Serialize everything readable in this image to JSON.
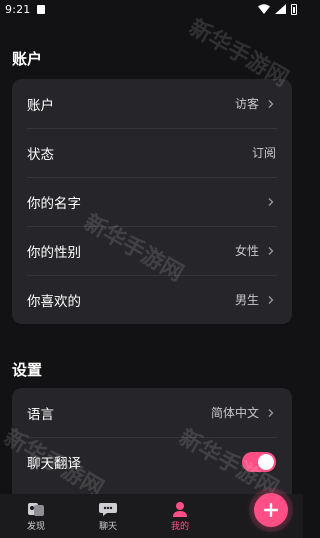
{
  "status_bar": {
    "time": "9:21",
    "notification_icon": "a-notification-icon",
    "wifi_icon": "wifi-icon",
    "cell_icon": "cell-signal-icon",
    "battery_icon": "battery-icon"
  },
  "account": {
    "title": "账户",
    "rows": [
      {
        "label": "账户",
        "value": "访客",
        "chevron": true
      },
      {
        "label": "状态",
        "value": "订阅",
        "chevron": false
      },
      {
        "label": "你的名字",
        "value": "",
        "chevron": true
      },
      {
        "label": "你的性别",
        "value": "女性",
        "chevron": true
      },
      {
        "label": "你喜欢的",
        "value": "男生",
        "chevron": true
      }
    ]
  },
  "settings": {
    "title": "设置",
    "rows": [
      {
        "label": "语言",
        "value": "简体中文",
        "chevron": true
      },
      {
        "label": "聊天翻译",
        "toggle_on": true
      }
    ]
  },
  "tabbar": {
    "tabs": [
      {
        "label": "发现",
        "icon": "discover-icon",
        "active": false
      },
      {
        "label": "聊天",
        "icon": "chat-icon",
        "active": false
      },
      {
        "label": "我的",
        "icon": "profile-icon",
        "active": true
      }
    ],
    "fab_icon": "plus-icon"
  },
  "watermark": "新华手游网",
  "colors": {
    "accent": "#ff4f86",
    "background": "#121214",
    "card": "#26262a"
  }
}
